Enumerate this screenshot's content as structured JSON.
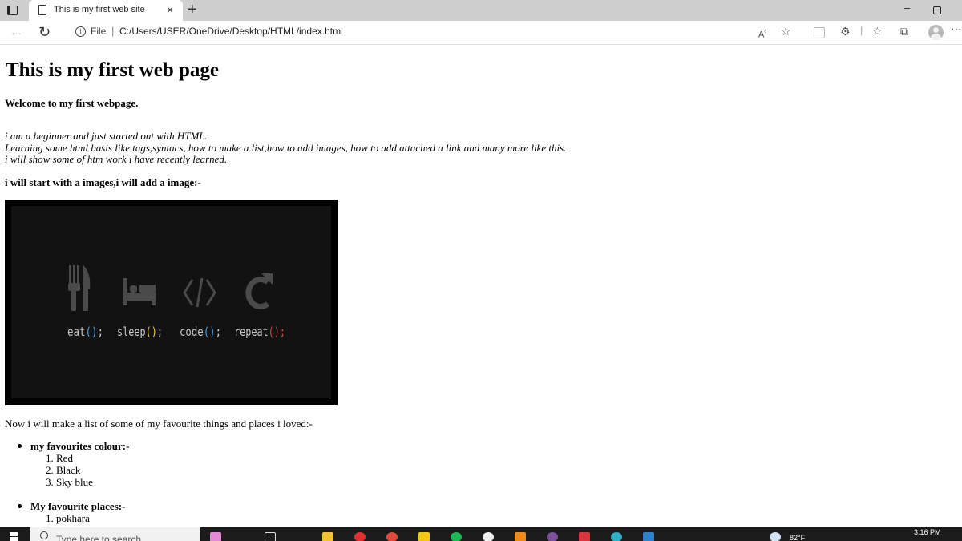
{
  "browser": {
    "tab_title": "This is my first web site",
    "tab_close": "×",
    "new_tab": "+",
    "scheme_label": "File",
    "url": "C:/Users/USER/OneDrive/Desktop/HTML/index.html",
    "read_aloud_label": "A̅",
    "icons": [
      "tab-actions-icon",
      "page-icon",
      "close-icon",
      "plus-icon",
      "back-arrow-icon",
      "reload-icon",
      "info-icon",
      "read-aloud-icon",
      "add-favorite-icon",
      "collections-icon",
      "extensions-icon",
      "favorites-icon",
      "profile-avatar-icon",
      "more-icon"
    ]
  },
  "page": {
    "heading": "This is my first web page",
    "welcome": "Welcome to my first webpage.",
    "intro_lines": [
      "i am a beginner and just started out with HTML.",
      "Learning some html basis like tags,syntacs, how to make a list,how to add images, how to add attached a link and many more like this.",
      "i will show some of htm work i have recently learned."
    ],
    "image_heading": "i will start with a images,i will add a image:-",
    "image": {
      "words": [
        "eat",
        "sleep",
        "code",
        "repeat"
      ],
      "punct": [
        "();",
        "();",
        "();",
        "();"
      ],
      "word_color": "#c8c8c8",
      "paren_colors": [
        "#4a9de0",
        "#e6c84a",
        "#4a9de0",
        "#d64545"
      ],
      "icon_color": "#4a4a4a",
      "icons": [
        "fork-knife-icon",
        "bed-icon",
        "code-brackets-icon",
        "repeat-arrow-icon"
      ]
    },
    "list_intro": "Now i will make a list of some of my favourite things and places i loved:-",
    "lists": [
      {
        "label": "my favourites colour:-",
        "items": [
          "Red",
          "Black",
          "Sky blue"
        ]
      },
      {
        "label": "My favourite places:-",
        "items": [
          "pokhara"
        ]
      }
    ]
  },
  "taskbar": {
    "search_placeholder": "Type here to search",
    "weather": "82°F",
    "time": "3:16 PM"
  }
}
